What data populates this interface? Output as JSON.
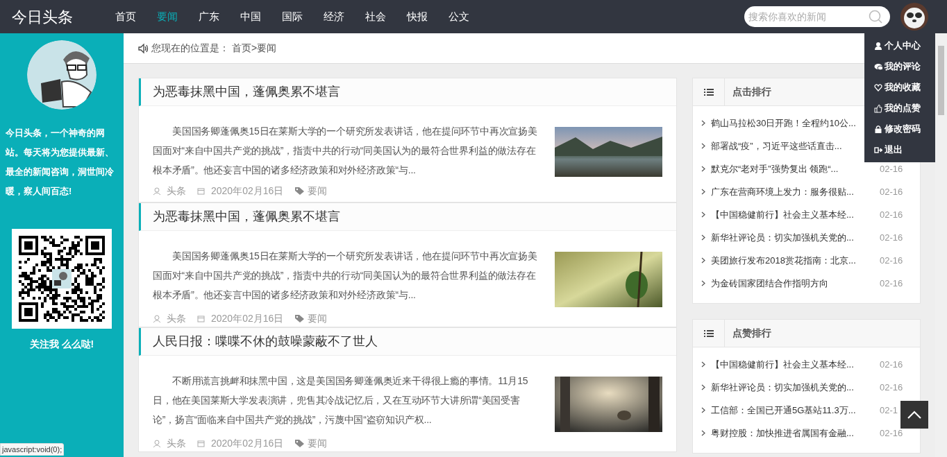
{
  "header": {
    "logo": "今日头条",
    "nav": [
      {
        "label": "首页",
        "selected": false
      },
      {
        "label": "要闻",
        "selected": true
      },
      {
        "label": "广东",
        "selected": false
      },
      {
        "label": "中国",
        "selected": false
      },
      {
        "label": "国际",
        "selected": false
      },
      {
        "label": "经济",
        "selected": false
      },
      {
        "label": "社会",
        "selected": false
      },
      {
        "label": "快报",
        "selected": false
      },
      {
        "label": "公文",
        "selected": false
      }
    ],
    "search": {
      "placeholder": "搜索你喜欢的新闻"
    },
    "user_menu": [
      {
        "kind": "user",
        "label": "个人中心"
      },
      {
        "kind": "comments",
        "label": "我的评论"
      },
      {
        "kind": "heart",
        "label": "我的收藏"
      },
      {
        "kind": "thumb",
        "label": "我的点赞"
      },
      {
        "kind": "lock",
        "label": "修改密码"
      },
      {
        "kind": "exit",
        "label": "退出"
      }
    ]
  },
  "sidebar": {
    "intro": "今日头条，一个神奇的网站。每天将为您提供最新、最全的新闻咨询，洞世间冷暖，察人间百态!",
    "follow": "关注我 么么哒!"
  },
  "breadcrumb": {
    "label": "您现在的位置是：",
    "path": "首页>要闻"
  },
  "articles": [
    {
      "title": "为恶毒抹黑中国，蓬佩奥累不堪言",
      "summary": "美国国务卿蓬佩奥15日在莱斯大学的一个研究所发表讲话，他在提问环节中再次宣扬美国面对“来自中国共产党的挑战”，指责中共的行动“同美国认为的最符合世界利益的做法存在根本矛盾”。他还妄言中国的诸多经济政策和对外经济政策“与...",
      "author": "头条",
      "date": "2020年02月16日",
      "tag": "要闻",
      "kind": "lake"
    },
    {
      "title": "为恶毒抹黑中国，蓬佩奥累不堪言",
      "summary": "美国国务卿蓬佩奥15日在莱斯大学的一个研究所发表讲话，他在提问环节中再次宣扬美国面对“来自中国共产党的挑战”，指责中共的行动“同美国认为的最符合世界利益的做法存在根本矛盾”。他还妄言中国的诸多经济政策和对外经济政策“与...",
      "author": "头条",
      "date": "2020年02月16日",
      "tag": "要闻",
      "kind": "leaf"
    },
    {
      "title": "人民日报：喋喋不休的鼓噪蒙蔽不了世人",
      "summary": "不断用谎言挑衅和抹黑中国，这是美国国务卿蓬佩奥近来干得很上瘾的事情。11月15日，他在美国莱斯大学发表演讲，兜售其冷战记忆后，又在互动环节大讲所谓“美国受害论”，扬言“面临来自中国共产党的挑战”，污蔑中国“盗窃知识产权...",
      "author": "头条",
      "date": "2020年02月16日",
      "tag": "要闻",
      "kind": "deer"
    }
  ],
  "rankings": [
    {
      "title": "点击排行",
      "items": [
        {
          "text": "鹤山马拉松30日开跑！全程约10公..."
        },
        {
          "text": "部署战“疫”，习近平这些话直击..."
        },
        {
          "text": "默克尔“老对手”强势复出 领跑“...",
          "date": "02-16"
        },
        {
          "text": "广东在营商环境上发力：服务很贴...",
          "date": "02-16"
        },
        {
          "text": "【中国稳健前行】社会主义基本经...",
          "date": "02-16"
        },
        {
          "text": "新华社评论员：切实加强机关党的...",
          "date": "02-16"
        },
        {
          "text": "美团旅行发布2018赏花指南：北京...",
          "date": "02-16"
        },
        {
          "text": "为金砖国家团结合作指明方向",
          "date": "02-16"
        }
      ]
    },
    {
      "title": "点赞排行",
      "items": [
        {
          "text": "【中国稳健前行】社会主义基本经...",
          "date": "02-16"
        },
        {
          "text": "新华社评论员：切实加强机关党的...",
          "date": "02-16"
        },
        {
          "text": "工信部：全国已开通5G基站11.3万...",
          "date": "02-1"
        },
        {
          "text": "粤财控股：加快推进省属国有金融...",
          "date": "02-16"
        }
      ]
    }
  ],
  "status_bar": "javascript:void(0);"
}
